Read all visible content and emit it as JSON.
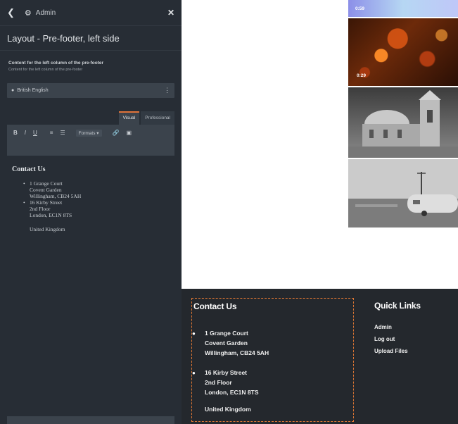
{
  "panel": {
    "top_label": "Admin",
    "title": "Layout - Pre-footer, left side",
    "field_label": "Content for the left column of the pre-footer",
    "field_description": "Content for the left column of the pre-footer",
    "language": "British English",
    "editor_tabs": [
      {
        "label": "Visual",
        "active": true
      },
      {
        "label": "Professional",
        "active": false
      }
    ],
    "toolbar": {
      "bold": "B",
      "italic": "I",
      "underline": "U",
      "formats": "Formats ▾"
    },
    "content": {
      "heading": "Contact Us",
      "items": [
        {
          "line1": "1 Grange Court",
          "line2": "Covent Garden",
          "line3": "Willingham, CB24 5AH"
        },
        {
          "line1": "16 Kirby Street",
          "line2": "2nd Floor",
          "line3": "London, EC1N 8TS"
        }
      ],
      "country": "United Kingdom"
    }
  },
  "preview": {
    "thumbnails": [
      {
        "duration": "0:59"
      },
      {
        "duration": "0:29"
      }
    ],
    "prefooter": {
      "left_heading": "Contact Us",
      "addresses": [
        {
          "line1": "1 Grange Court",
          "line2": "Covent Garden",
          "line3": "Willingham, CB24 5AH"
        },
        {
          "line1": "16 Kirby Street",
          "line2": "2nd Floor",
          "line3": "London, EC1N 8TS"
        }
      ],
      "country": "United Kingdom",
      "right_heading": "Quick Links",
      "links": [
        "Admin",
        "Log out",
        "Upload Files"
      ]
    }
  },
  "colors": {
    "panel_bg": "#272d35",
    "prefooter_bg": "#24282d",
    "accent": "#e07733"
  }
}
